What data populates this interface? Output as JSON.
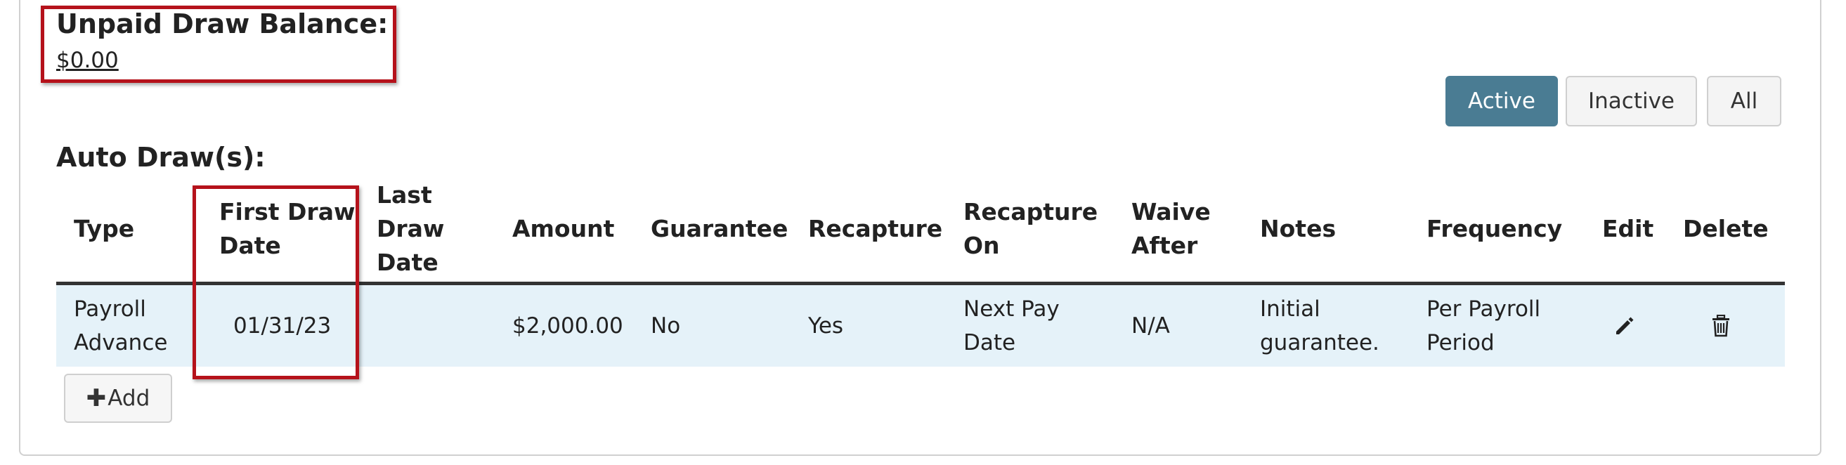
{
  "balance": {
    "title": "Unpaid Draw Balance:",
    "value": "$0.00"
  },
  "filters": {
    "active": "Active",
    "inactive": "Inactive",
    "all": "All",
    "selected": "Active",
    "accent_color": "#4a7c93"
  },
  "section": {
    "title": "Auto Draw(s):"
  },
  "table": {
    "headers": {
      "type": "Type",
      "first_draw_date": [
        "First Draw",
        "Date"
      ],
      "last_draw_date": [
        "Last",
        "Draw",
        "Date"
      ],
      "amount": "Amount",
      "guarantee": "Guarantee",
      "recapture": "Recapture",
      "recapture_on": [
        "Recapture",
        "On"
      ],
      "waive_after": [
        "Waive",
        "After"
      ],
      "notes": "Notes",
      "frequency": "Frequency",
      "edit": "Edit",
      "delete": "Delete"
    },
    "rows": [
      {
        "type": [
          "Payroll",
          "Advance"
        ],
        "first_draw_date": "01/31/23",
        "last_draw_date": "",
        "amount": "$2,000.00",
        "guarantee": "No",
        "recapture": "Yes",
        "recapture_on": [
          "Next Pay",
          "Date"
        ],
        "waive_after": "N/A",
        "notes": [
          "Initial",
          "guarantee."
        ],
        "frequency": [
          "Per Payroll",
          "Period"
        ],
        "edit_icon": "pencil-icon",
        "delete_icon": "trash-icon"
      }
    ],
    "row_color": "#e5f2f9"
  },
  "add_button": {
    "icon": "plus-icon",
    "label": "Add"
  },
  "highlight_color": "#b5121b"
}
